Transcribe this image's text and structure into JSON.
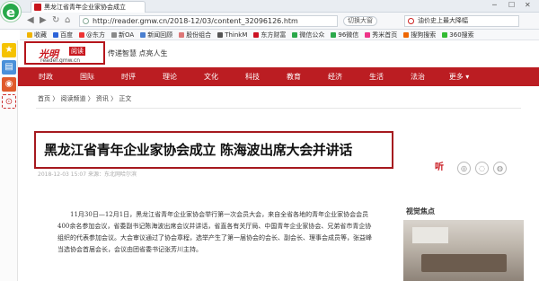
{
  "browser": {
    "tab_title": "黑龙江省青年企业家协会成立",
    "url": "http://reader.gmw.cn/2018-12/03/content_32096126.htm",
    "zoom_label": "切换大窗",
    "search_text": "油价史上最大降幅",
    "bookmarks": [
      {
        "label": "收藏",
        "color": "#f0b400"
      },
      {
        "label": "百度",
        "color": "#2b62d8"
      },
      {
        "label": "@东方",
        "color": "#e33"
      },
      {
        "label": "新OA",
        "color": "#8a8a8a"
      },
      {
        "label": "新闻回顾",
        "color": "#4a7fd0"
      },
      {
        "label": "股份组合",
        "color": "#d77"
      },
      {
        "label": "ThinkM",
        "color": "#555"
      },
      {
        "label": "东方财富",
        "color": "#c12"
      },
      {
        "label": "微信公众",
        "color": "#2aa84a"
      },
      {
        "label": "96微信",
        "color": "#2aa84a"
      },
      {
        "label": "秀米首页",
        "color": "#e38"
      },
      {
        "label": "搜狗搜索",
        "color": "#e60"
      },
      {
        "label": "360搜索",
        "color": "#3b3"
      }
    ]
  },
  "site": {
    "logo_text": "光明",
    "logo_tag": "阅读",
    "logo_url": "reader.gmw.cn",
    "slogan": "传递智慧  点亮人生",
    "nav": [
      "时政",
      "国际",
      "时评",
      "理论",
      "文化",
      "科技",
      "教育",
      "经济",
      "生活",
      "法治",
      "更多 ▾"
    ],
    "breadcrumb": "首页 〉 阅读频道 〉 资讯 〉 正文"
  },
  "article": {
    "headline": "黑龙江省青年企业家协会成立  陈海波出席大会并讲话",
    "meta": "2018-12-03 15:07  来源：东北网哈尔滨",
    "body": "11月30日—12月1日，黑龙江省青年企业家协会举行第一次会员大会，来自全省各地的青年企业家协会会员400余名参加会议，省委副书记陈海波出席会议并讲话，省直各有关厅局、中国青年企业家协会、兄弟省市青企协组织的代表参加会议。大会审议通过了协会章程，选举产生了第一届协会的会长、副会长、理事会成员等，张益峰当选协会首届会长，会议由团省委书记张芳川主持。"
  },
  "sidebar": {
    "title": "视觉焦点"
  },
  "share_icons": [
    "听",
    "朋友圈",
    "微信",
    "微博"
  ]
}
